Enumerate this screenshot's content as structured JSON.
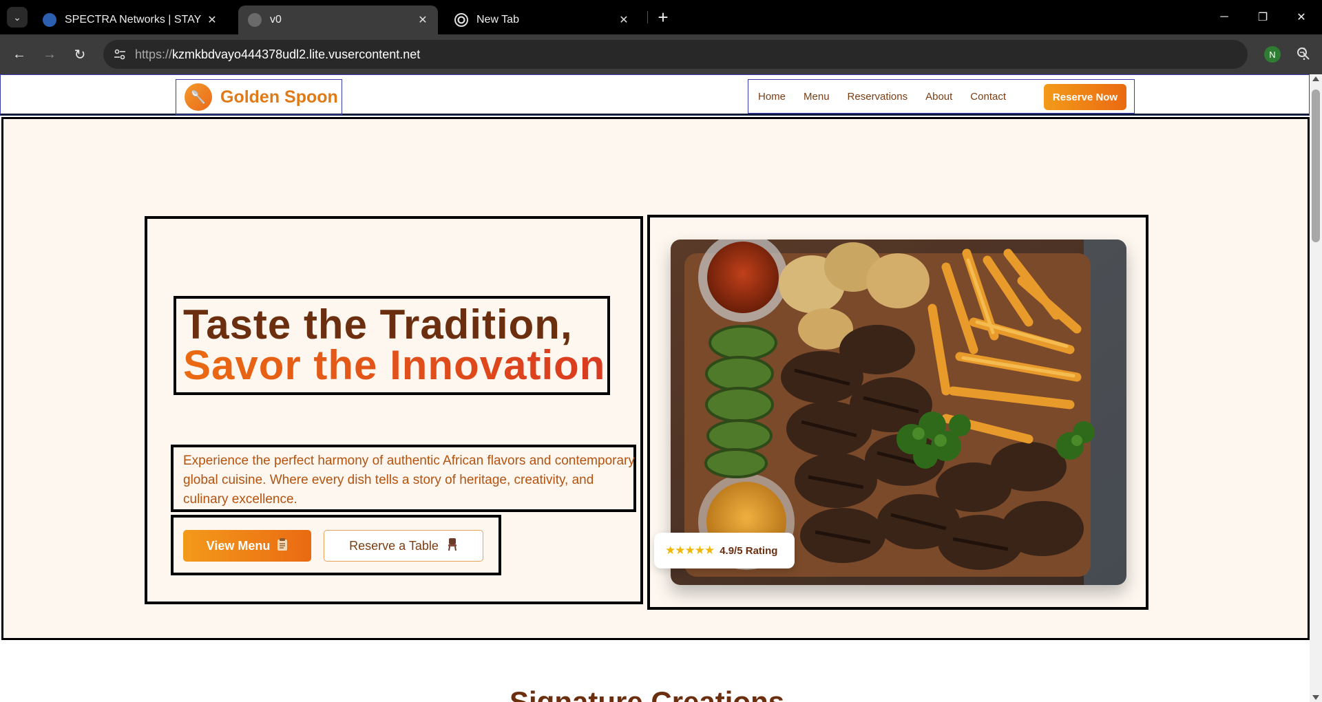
{
  "browser": {
    "tabs": [
      {
        "title": "SPECTRA Networks | STAY SAFE",
        "favicon": "spectra-favicon",
        "active": false
      },
      {
        "title": "v0",
        "favicon": "globe-icon",
        "active": true
      },
      {
        "title": "New Tab",
        "favicon": "chrome-icon",
        "active": false
      }
    ],
    "url_scheme": "https://",
    "url_host": "kzmkbdvayo444378udl2.lite.vusercontent.net",
    "profile_initial": "N",
    "star_color": "#7cb7ff"
  },
  "site": {
    "brand_name": "Golden Spoon",
    "brand_icon": "spoon-icon",
    "nav": [
      "Home",
      "Menu",
      "Reservations",
      "About",
      "Contact"
    ],
    "reserve_now": "Reserve Now",
    "colors": {
      "accent": "#ea6a12",
      "brown": "#6b2f10",
      "cream": "#fdf7f0"
    }
  },
  "hero": {
    "headline_line1": "Taste the Tradition,",
    "headline_line2": "Savor the Innovation",
    "description": "Experience the perfect harmony of authentic African flavors and contemporary global cuisine. Where every dish tells a story of heritage, creativity, and culinary excellence.",
    "primary_button": "View Menu",
    "primary_button_icon": "menu-clipboard-icon",
    "secondary_button": "Reserve a Table",
    "secondary_button_icon": "chair-icon",
    "rating_stars": "★★★★★",
    "rating_text": "4.9/5 Rating"
  },
  "next_section": {
    "title": "Signature Creations"
  }
}
